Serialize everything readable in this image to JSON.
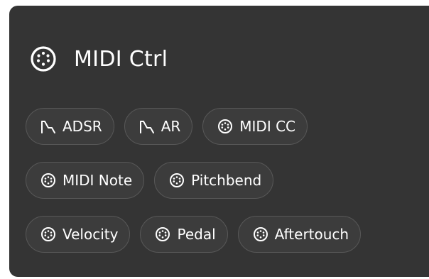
{
  "panel": {
    "title": "MIDI Ctrl",
    "title_icon": "midi-din-connector-icon"
  },
  "chips": [
    [
      {
        "label": "ADSR",
        "icon": "adsr-envelope-icon"
      },
      {
        "label": "AR",
        "icon": "adsr-envelope-icon"
      },
      {
        "label": "MIDI CC",
        "icon": "midi-din-connector-icon"
      }
    ],
    [
      {
        "label": "MIDI Note",
        "icon": "midi-din-connector-icon"
      },
      {
        "label": "Pitchbend",
        "icon": "midi-din-connector-icon"
      }
    ],
    [
      {
        "label": "Velocity",
        "icon": "midi-din-connector-icon"
      },
      {
        "label": "Pedal",
        "icon": "midi-din-connector-icon"
      },
      {
        "label": "Aftertouch",
        "icon": "midi-din-connector-icon"
      }
    ]
  ],
  "colors": {
    "panel_bg": "#343434",
    "chip_bg": "#3c3c3c",
    "chip_border": "#585858",
    "text": "#ffffff"
  }
}
